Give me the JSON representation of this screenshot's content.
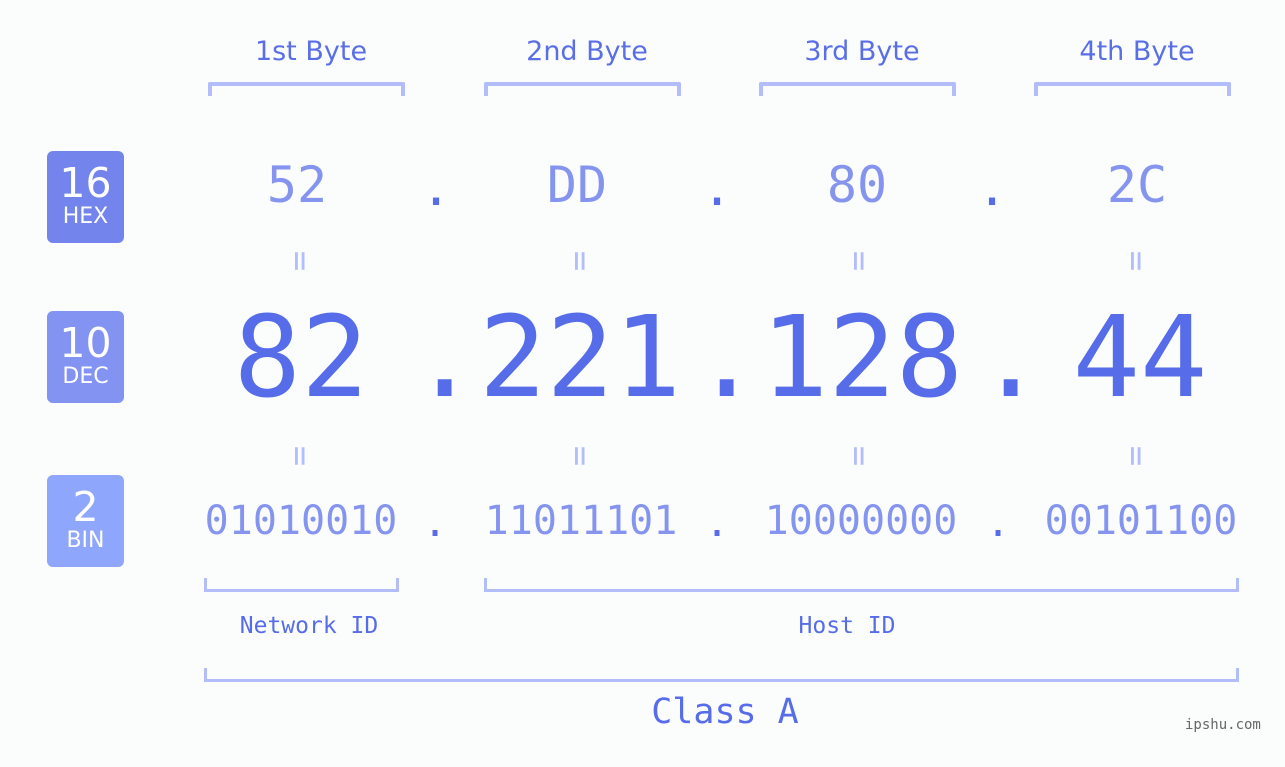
{
  "colors": {
    "accent": "#566ce9",
    "hex_badge": "#7385ec",
    "dec_badge": "#8293f2",
    "bin_badge": "#8ea6fb",
    "bracket": "#b3bdfa",
    "light_value": "#8595ef",
    "background": "#fbfdfc"
  },
  "bytes": [
    {
      "label": "1st Byte",
      "hex": "52",
      "dec": "82",
      "bin": "01010010"
    },
    {
      "label": "2nd Byte",
      "hex": "DD",
      "dec": "221",
      "bin": "11011101"
    },
    {
      "label": "3rd Byte",
      "hex": "80",
      "dec": "128",
      "bin": "10000000"
    },
    {
      "label": "4th Byte",
      "hex": "2C",
      "dec": "44",
      "bin": "00101100"
    }
  ],
  "separator": ".",
  "equals": "=",
  "badges": {
    "hex": {
      "number": "16",
      "label": "HEX"
    },
    "dec": {
      "number": "10",
      "label": "DEC"
    },
    "bin": {
      "number": "2",
      "label": "BIN"
    }
  },
  "network_id_label": "Network ID",
  "host_id_label": "Host ID",
  "class_label": "Class A",
  "watermark": "ipshu.com"
}
